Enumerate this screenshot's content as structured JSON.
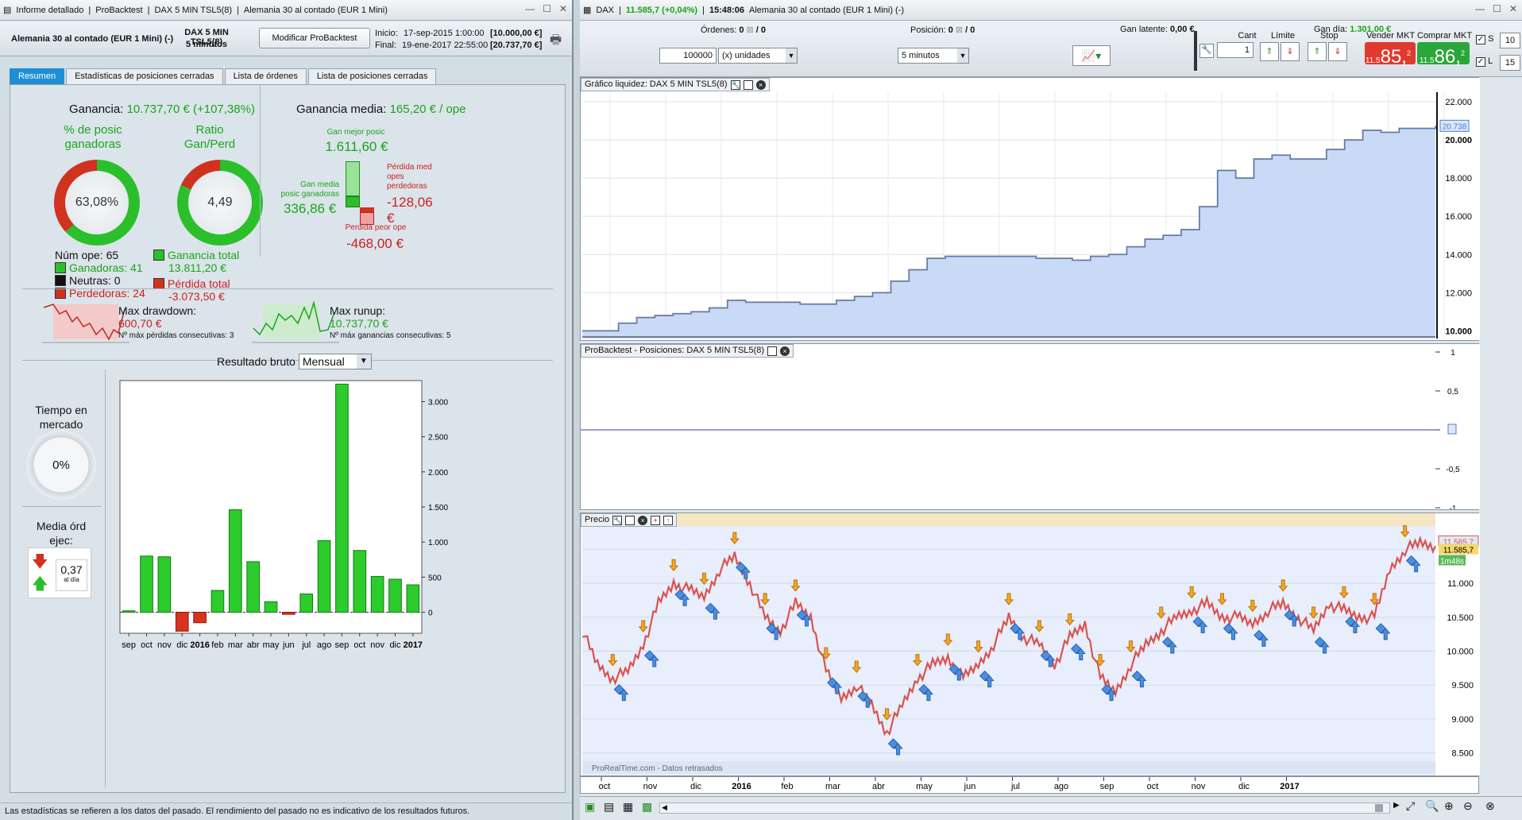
{
  "left_window": {
    "title_items": [
      "Informe detallado",
      "ProBacktest",
      "DAX 5 MIN TSL5(8)",
      "Alemania 30 al contado (EUR 1 Mini)"
    ],
    "instrument": "Alemania 30 al contado (EUR 1 Mini) (-)",
    "system": "DAX 5 MIN TSL5(8)",
    "timeframe": "5 minutos",
    "modify_button": "Modificar ProBacktest",
    "start_label": "Inicio:",
    "start_date": "17-sep-2015 1:00:00",
    "start_capital": "[10.000,00 €]",
    "end_label": "Final:",
    "end_date": "19-ene-2017 22:55:00",
    "end_capital": "[20.737,70 €]",
    "tabs": [
      "Resumen",
      "Estadísticas de posiciones cerradas",
      "Lista de órdenes",
      "Lista de posiciones cerradas"
    ],
    "summary": {
      "gain_label": "Ganancia:",
      "gain_value": "10.737,70 € (+107,38%)",
      "pct_win_label_1": "% de posic",
      "pct_win_label_2": "ganadoras",
      "pct_win_value": "63,08%",
      "pct_win_fraction": 0.6308,
      "ratio_label_1": "Ratio",
      "ratio_label_2": "Gan/Perd",
      "ratio_value": "4,49",
      "ratio_fraction": 0.818,
      "num_ope": "Núm ope: 65",
      "winners": "Ganadoras: 41",
      "neutral": "Neutras: 0",
      "losers": "Perdedoras: 24",
      "total_gain_label": "Ganancia total",
      "total_gain_value": "13.811,20 €",
      "total_loss_label": "Pérdida total",
      "total_loss_value": "-3.073,50 €",
      "avg_gain_label": "Ganancia media:",
      "avg_gain_value": "165,20 € / ope",
      "best_label": "Gan mejor posic",
      "best_value": "1.611,60 €",
      "avg_win_label_1": "Gan media",
      "avg_win_label_2": "posic ganadoras",
      "avg_win_value": "336,86 €",
      "avg_loss_label_1": "Pérdida med",
      "avg_loss_label_2": "opes",
      "avg_loss_label_3": "perdedoras",
      "avg_loss_value": "-128,06",
      "avg_loss_unit": "€",
      "worst_label": "Perdida peor ope",
      "worst_value": "-468,00 €",
      "drawdown_label": "Max drawdown:",
      "drawdown_value": "600,70 €",
      "drawdown_sub": "Nº máx pérdidas consecutivas: 3",
      "runup_label": "Max runup:",
      "runup_value": "10.737,70 €",
      "runup_sub": "Nº máx ganancias consecutivas: 5",
      "time_label_1": "Tiempo en",
      "time_label_2": "mercado",
      "time_value": "0%",
      "orders_label_1": "Media órd",
      "orders_label_2": "ejec:",
      "orders_value": "0,37",
      "orders_unit": "al día",
      "result_label": "Resultado bruto",
      "result_select": "Mensual"
    },
    "footer": "Las estadísticas se refieren a los datos del pasado. El rendimiento del pasado no es indicativo de los resultados futuros."
  },
  "right_window": {
    "title": "DAX",
    "price": "11.585,7 (+0,04%)",
    "time": "15:48:06",
    "instrument": "Alemania 30 al contado (EUR 1 Mini) (-)",
    "orders_label": "Órdenes:",
    "orders_val1": "0",
    "orders_val2": "/ 0",
    "position_label": "Posición:",
    "position_val1": "0",
    "position_val2": "/ 0",
    "latent_label": "Gan latente:",
    "latent_value": "0,00 €",
    "day_label": "Gan día:",
    "day_value": "1.301,00 €",
    "qty_value": "100000",
    "units": "(x) unidades",
    "period": "5 minutos",
    "cant_label": "Cant",
    "cant_value": "1",
    "limit_label": "Límite",
    "stop_label": "Stop",
    "sell_label": "Vender MKT",
    "sell_small": "11.5",
    "sell_big": "85,",
    "sell_sup": "2",
    "buy_label": "Comprar MKT",
    "buy_small": "11.5",
    "buy_big": "86,",
    "buy_sup": "2",
    "s_label": "S",
    "s_value": "10",
    "l_label": "L",
    "l_value": "15",
    "pane1_title": "Gráfico liquidez: DAX 5 MIN TSL5(8)",
    "pane1_last": "20.738",
    "pane1_axis": [
      "22.000",
      "20.000",
      "18.000",
      "16.000",
      "14.000",
      "12.000",
      "10.000"
    ],
    "pane2_title": "ProBacktest - Posiciones: DAX 5 MIN TSL5(8)",
    "pane2_axis": [
      "1",
      "0,5",
      "0",
      "-0,5",
      "-1"
    ],
    "pane3_title": "Precio",
    "pane3_axis": [
      "11.500",
      "11.000",
      "10.500",
      "10.000",
      "9.500",
      "9.000",
      "8.500"
    ],
    "pane3_last1": "11.585,7",
    "pane3_last2": "11.585,7",
    "pane3_timer": "1m48s",
    "watermark": "ProRealTime.com - Datos retrasados",
    "x_labels": [
      "oct",
      "nov",
      "dic",
      "2016",
      "feb",
      "mar",
      "abr",
      "may",
      "jun",
      "jul",
      "ago",
      "sep",
      "oct",
      "nov",
      "dic",
      "2017"
    ]
  },
  "chart_data": [
    {
      "type": "bar",
      "title": "Resultado bruto",
      "categories": [
        "sep",
        "oct",
        "nov",
        "dic",
        "2016",
        "feb",
        "mar",
        "abr",
        "may",
        "jun",
        "jul",
        "ago",
        "sep",
        "oct",
        "nov",
        "dic",
        "2017"
      ],
      "values": [
        20,
        800,
        790,
        -270,
        -150,
        310,
        1460,
        720,
        150,
        -30,
        260,
        1020,
        3250,
        880,
        510,
        470,
        390
      ],
      "ylim": [
        -300,
        3300
      ],
      "yticks": [
        "3.000",
        "2.500",
        "2.000",
        "1.500",
        "1.000",
        "500",
        "0"
      ]
    },
    {
      "type": "area",
      "title": "Gráfico liquidez: DAX 5 MIN TSL5(8)",
      "ylim": [
        9600,
        22500
      ],
      "values": [
        10000,
        10000,
        10400,
        10700,
        10800,
        10900,
        11000,
        11200,
        11600,
        11500,
        11500,
        11500,
        11400,
        11400,
        11600,
        11800,
        12000,
        12600,
        13200,
        13800,
        13900,
        13900,
        13900,
        13900,
        13900,
        13800,
        13800,
        13700,
        13900,
        14000,
        14400,
        14800,
        15000,
        15300,
        16500,
        18400,
        18000,
        19000,
        19200,
        19000,
        19000,
        19500,
        20000,
        20500,
        20400,
        20600,
        20600,
        20738
      ]
    },
    {
      "type": "line",
      "title": "Precio",
      "ylim": [
        8400,
        11800
      ],
      "values": [
        10300,
        9800,
        9600,
        9700,
        10100,
        10700,
        11000,
        10900,
        10800,
        11200,
        11400,
        11000,
        10500,
        10300,
        10700,
        10500,
        9700,
        9300,
        9500,
        9200,
        8800,
        9200,
        9600,
        9800,
        9900,
        9600,
        9800,
        10100,
        10500,
        10200,
        10100,
        9800,
        10200,
        10400,
        9600,
        9400,
        9800,
        10100,
        10300,
        10500,
        10600,
        10700,
        10500,
        10500,
        10400,
        10600,
        10700,
        10500,
        10300,
        10700,
        10600,
        10500,
        10500,
        11200,
        11500,
        11600,
        11550
      ]
    }
  ]
}
